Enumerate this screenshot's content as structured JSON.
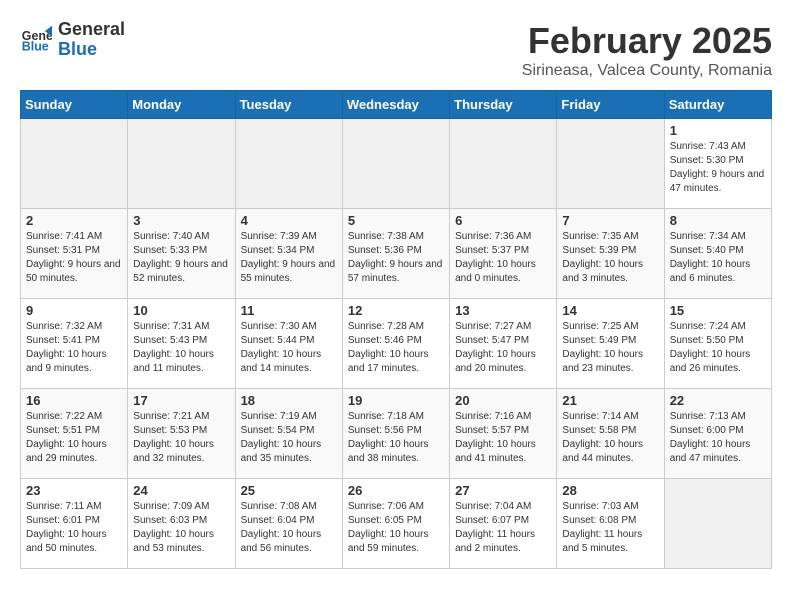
{
  "header": {
    "logo_line1": "General",
    "logo_line2": "Blue",
    "title": "February 2025",
    "subtitle": "Sirineasa, Valcea County, Romania"
  },
  "days_of_week": [
    "Sunday",
    "Monday",
    "Tuesday",
    "Wednesday",
    "Thursday",
    "Friday",
    "Saturday"
  ],
  "weeks": [
    [
      {
        "day": "",
        "info": ""
      },
      {
        "day": "",
        "info": ""
      },
      {
        "day": "",
        "info": ""
      },
      {
        "day": "",
        "info": ""
      },
      {
        "day": "",
        "info": ""
      },
      {
        "day": "",
        "info": ""
      },
      {
        "day": "1",
        "info": "Sunrise: 7:43 AM\nSunset: 5:30 PM\nDaylight: 9 hours and 47 minutes."
      }
    ],
    [
      {
        "day": "2",
        "info": "Sunrise: 7:41 AM\nSunset: 5:31 PM\nDaylight: 9 hours and 50 minutes."
      },
      {
        "day": "3",
        "info": "Sunrise: 7:40 AM\nSunset: 5:33 PM\nDaylight: 9 hours and 52 minutes."
      },
      {
        "day": "4",
        "info": "Sunrise: 7:39 AM\nSunset: 5:34 PM\nDaylight: 9 hours and 55 minutes."
      },
      {
        "day": "5",
        "info": "Sunrise: 7:38 AM\nSunset: 5:36 PM\nDaylight: 9 hours and 57 minutes."
      },
      {
        "day": "6",
        "info": "Sunrise: 7:36 AM\nSunset: 5:37 PM\nDaylight: 10 hours and 0 minutes."
      },
      {
        "day": "7",
        "info": "Sunrise: 7:35 AM\nSunset: 5:39 PM\nDaylight: 10 hours and 3 minutes."
      },
      {
        "day": "8",
        "info": "Sunrise: 7:34 AM\nSunset: 5:40 PM\nDaylight: 10 hours and 6 minutes."
      }
    ],
    [
      {
        "day": "9",
        "info": "Sunrise: 7:32 AM\nSunset: 5:41 PM\nDaylight: 10 hours and 9 minutes."
      },
      {
        "day": "10",
        "info": "Sunrise: 7:31 AM\nSunset: 5:43 PM\nDaylight: 10 hours and 11 minutes."
      },
      {
        "day": "11",
        "info": "Sunrise: 7:30 AM\nSunset: 5:44 PM\nDaylight: 10 hours and 14 minutes."
      },
      {
        "day": "12",
        "info": "Sunrise: 7:28 AM\nSunset: 5:46 PM\nDaylight: 10 hours and 17 minutes."
      },
      {
        "day": "13",
        "info": "Sunrise: 7:27 AM\nSunset: 5:47 PM\nDaylight: 10 hours and 20 minutes."
      },
      {
        "day": "14",
        "info": "Sunrise: 7:25 AM\nSunset: 5:49 PM\nDaylight: 10 hours and 23 minutes."
      },
      {
        "day": "15",
        "info": "Sunrise: 7:24 AM\nSunset: 5:50 PM\nDaylight: 10 hours and 26 minutes."
      }
    ],
    [
      {
        "day": "16",
        "info": "Sunrise: 7:22 AM\nSunset: 5:51 PM\nDaylight: 10 hours and 29 minutes."
      },
      {
        "day": "17",
        "info": "Sunrise: 7:21 AM\nSunset: 5:53 PM\nDaylight: 10 hours and 32 minutes."
      },
      {
        "day": "18",
        "info": "Sunrise: 7:19 AM\nSunset: 5:54 PM\nDaylight: 10 hours and 35 minutes."
      },
      {
        "day": "19",
        "info": "Sunrise: 7:18 AM\nSunset: 5:56 PM\nDaylight: 10 hours and 38 minutes."
      },
      {
        "day": "20",
        "info": "Sunrise: 7:16 AM\nSunset: 5:57 PM\nDaylight: 10 hours and 41 minutes."
      },
      {
        "day": "21",
        "info": "Sunrise: 7:14 AM\nSunset: 5:58 PM\nDaylight: 10 hours and 44 minutes."
      },
      {
        "day": "22",
        "info": "Sunrise: 7:13 AM\nSunset: 6:00 PM\nDaylight: 10 hours and 47 minutes."
      }
    ],
    [
      {
        "day": "23",
        "info": "Sunrise: 7:11 AM\nSunset: 6:01 PM\nDaylight: 10 hours and 50 minutes."
      },
      {
        "day": "24",
        "info": "Sunrise: 7:09 AM\nSunset: 6:03 PM\nDaylight: 10 hours and 53 minutes."
      },
      {
        "day": "25",
        "info": "Sunrise: 7:08 AM\nSunset: 6:04 PM\nDaylight: 10 hours and 56 minutes."
      },
      {
        "day": "26",
        "info": "Sunrise: 7:06 AM\nSunset: 6:05 PM\nDaylight: 10 hours and 59 minutes."
      },
      {
        "day": "27",
        "info": "Sunrise: 7:04 AM\nSunset: 6:07 PM\nDaylight: 11 hours and 2 minutes."
      },
      {
        "day": "28",
        "info": "Sunrise: 7:03 AM\nSunset: 6:08 PM\nDaylight: 11 hours and 5 minutes."
      },
      {
        "day": "",
        "info": ""
      }
    ]
  ]
}
